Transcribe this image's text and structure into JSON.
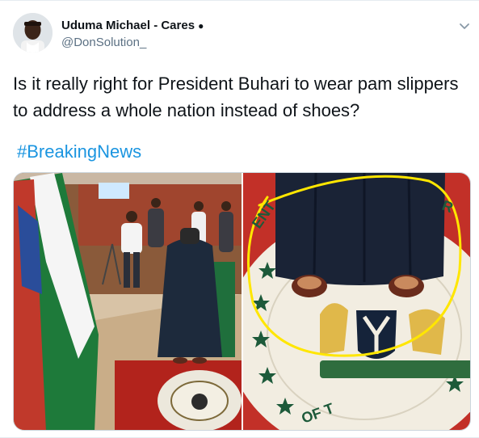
{
  "author": {
    "display_name": "Uduma Michael - Cares",
    "badge": "●",
    "handle": "@DonSolution_"
  },
  "tweet": {
    "text": "Is it really right for President Buhari to wear pam slippers to address a whole nation instead of shoes?",
    "hashtag": "#BreakingNews"
  },
  "icons": {
    "menu": "chevron-down-icon"
  },
  "colors": {
    "hashtag": "#1b95e0",
    "handle": "#5b7083",
    "highlight_circle": "#ffe600"
  }
}
